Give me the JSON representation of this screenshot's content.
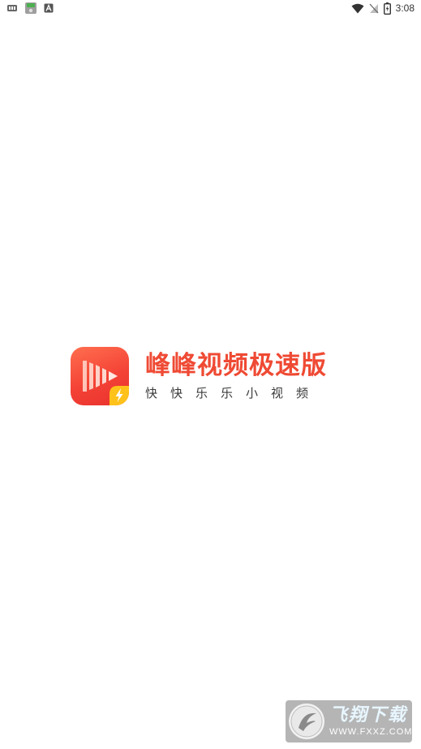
{
  "status_bar": {
    "time": "3:08",
    "left_icons": [
      "sim-card-icon",
      "android-robot-icon",
      "text-a-icon"
    ],
    "right_icons": [
      "wifi-icon",
      "no-signal-icon",
      "battery-icon"
    ]
  },
  "splash": {
    "app_icon": "play-video-lightning-icon",
    "title": "峰峰视频极速版",
    "subtitle": "快快乐乐小视频",
    "colors": {
      "title": "#ef4a34",
      "icon_gradient_start": "#ff6f4f",
      "icon_gradient_end": "#e8322d",
      "badge": "#ffc21a"
    }
  },
  "watermark": {
    "brand": "飞翔下载",
    "domain": "WWW.FXXZ.COM"
  }
}
